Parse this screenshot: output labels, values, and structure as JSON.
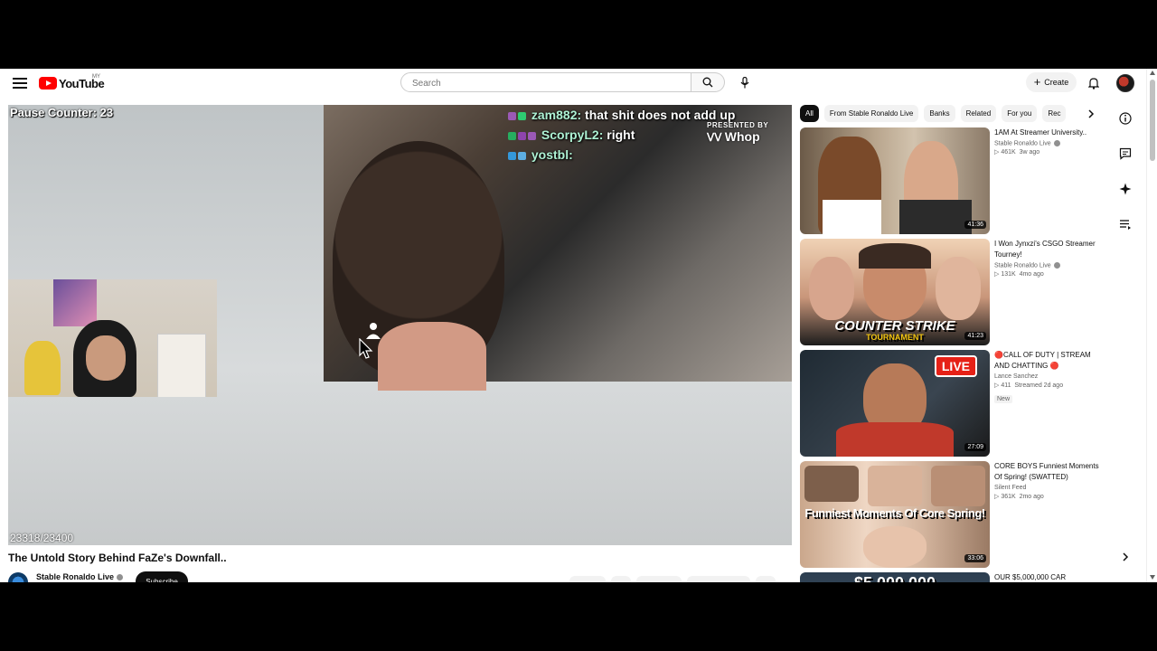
{
  "header": {
    "logo_text": "YouTube",
    "country_code": "MY",
    "search_placeholder": "Search",
    "create_label": "Create"
  },
  "player": {
    "pause_counter": "Pause Counter: 23",
    "frame_counter": "23318/23400",
    "sponsor_presented": "PRESENTED BY",
    "sponsor_brand": "Whop",
    "chat": [
      {
        "name": "zam882:",
        "message": "that shit does not add up"
      },
      {
        "name": "ScorpyL2:",
        "message": "right"
      },
      {
        "name": "yostbl:",
        "message": ""
      }
    ]
  },
  "video": {
    "title": "The Untold Story Behind FaZe's Downfall..",
    "channel": "Stable Ronaldo Live",
    "subscribe_label": "Subscribe"
  },
  "chips": [
    "All",
    "From Stable Ronaldo Live",
    "Banks",
    "Related",
    "For you",
    "Rec"
  ],
  "recommendations": [
    {
      "title": "1AM At Streamer University..",
      "channel": "Stable Ronaldo Live",
      "verified": true,
      "views": "461K",
      "age": "3w ago",
      "duration": "41:36",
      "badge": ""
    },
    {
      "title": "I Won Jynxzi's CSGO Streamer Tourney!",
      "channel": "Stable Ronaldo Live",
      "verified": true,
      "views": "131K",
      "age": "4mo ago",
      "duration": "41:23",
      "badge": "",
      "thumb_text": "COUNTER STRIKE",
      "thumb_sub": "TOURNAMENT"
    },
    {
      "title": "🔴CALL OF DUTY | STREAM AND CHATTING 🔴",
      "channel": "Lance Sanchez",
      "verified": false,
      "views": "411",
      "age": "Streamed 2d ago",
      "duration": "27:09",
      "badge": "New",
      "thumb_text": "LIVE"
    },
    {
      "title": "CORE BOYS Funniest Moments Of Spring! (SWATTED)",
      "channel": "Silent Feed",
      "verified": false,
      "views": "361K",
      "age": "2mo ago",
      "duration": "33:06",
      "badge": "",
      "thumb_text": "Funniest Moments Of Core Spring!"
    },
    {
      "title": "OUR $5,000,000 CAR",
      "channel": "",
      "verified": false,
      "views": "",
      "age": "",
      "duration": "",
      "badge": "",
      "thumb_text": "$5,000,000"
    }
  ],
  "colors": {
    "accent_red": "#ff0000",
    "chip_active_bg": "#0f0f0f",
    "chat_name": "#aef2d4"
  },
  "icons": {
    "menu": "hamburger-icon",
    "search": "search-icon",
    "mic": "mic-icon",
    "bell": "bell-icon",
    "info": "info-icon",
    "chat": "chat-icon",
    "sparkle": "sparkle-icon",
    "list": "playlist-icon"
  }
}
